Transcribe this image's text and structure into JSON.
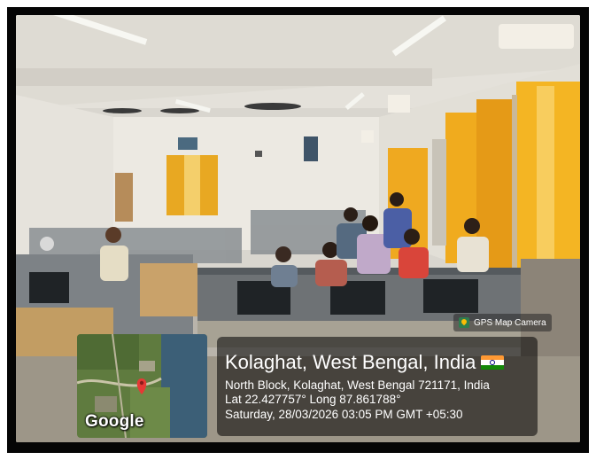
{
  "camera_app": {
    "label": "GPS Map Camera",
    "icon": "gps-map-camera-icon"
  },
  "map": {
    "provider_label": "Google",
    "pin_icon": "map-pin-icon"
  },
  "location": {
    "title": "Kolaghat, West Bengal, India",
    "flag": "india-flag-icon",
    "address": "North Block, Kolaghat, West Bengal 721171, India",
    "coordinates": "Lat 22.427757° Long 87.861788°",
    "datetime": "Saturday, 28/03/2026 03:05 PM GMT +05:30"
  },
  "colors": {
    "frame": "#050505",
    "curtain": "#f2b21c",
    "wall": "#e9e6df",
    "pin": "#e53935"
  }
}
